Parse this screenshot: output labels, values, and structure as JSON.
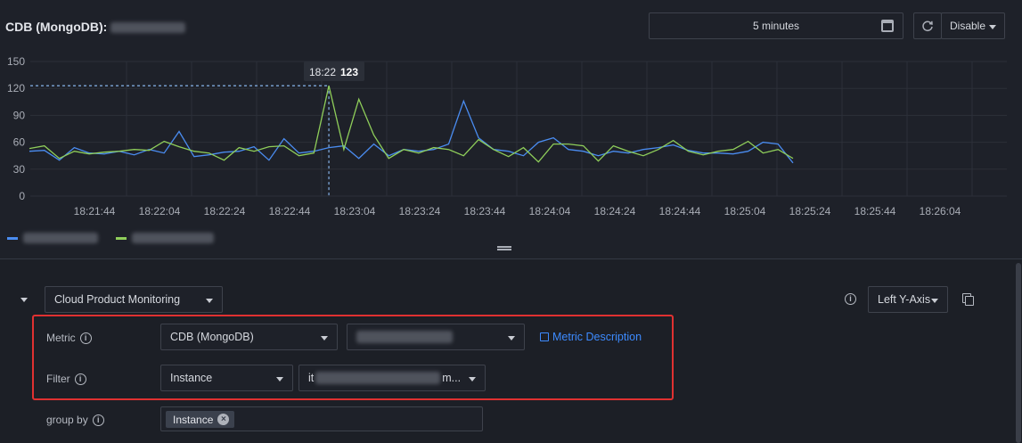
{
  "header": {
    "title": "CDB (MongoDB):",
    "time_range": "5 minutes",
    "auto_refresh": "Disable"
  },
  "colors": {
    "series_a": "#4a8cf0",
    "series_b": "#8fce5a",
    "accent_link": "#3d8bff",
    "highlight_box": "#e03131"
  },
  "chart_data": {
    "type": "line",
    "ylim": [
      0,
      150
    ],
    "y_ticks": [
      "150",
      "120",
      "90",
      "60",
      "30",
      "0"
    ],
    "x_ticks": [
      "18:21:44",
      "18:22:04",
      "18:22:24",
      "18:22:44",
      "18:23:04",
      "18:23:24",
      "18:23:44",
      "18:24:04",
      "18:24:24",
      "18:24:44",
      "18:25:04",
      "18:25:24",
      "18:25:44",
      "18:26:04"
    ],
    "tooltip": {
      "time": "18:22",
      "value": "123"
    },
    "series": [
      {
        "values": [
          50,
          51,
          40,
          54,
          48,
          47,
          50,
          46,
          52,
          48,
          72,
          44,
          46,
          49,
          50,
          55,
          40,
          64,
          48,
          50,
          54,
          56,
          42,
          58,
          45,
          52,
          50,
          52,
          58,
          106,
          65,
          52,
          50,
          45,
          60,
          65,
          52,
          50,
          45,
          50,
          48,
          52,
          54,
          57,
          51,
          48,
          48,
          47,
          50,
          60,
          58,
          37
        ]
      },
      {
        "values": [
          53,
          56,
          42,
          50,
          47,
          49,
          50,
          52,
          51,
          61,
          55,
          50,
          48,
          40,
          54,
          50,
          55,
          56,
          45,
          48,
          123,
          52,
          108,
          68,
          42,
          52,
          48,
          54,
          52,
          45,
          63,
          52,
          44,
          54,
          38,
          58,
          58,
          56,
          39,
          56,
          50,
          45,
          52,
          62,
          50,
          46,
          50,
          52,
          61,
          48,
          52,
          42
        ]
      }
    ]
  },
  "query": {
    "source": "Cloud Product Monitoring",
    "y_axis": "Left Y-Axis",
    "metric_label": "Metric",
    "metric_value": "CDB (MongoDB)",
    "metric_link": "Metric Description",
    "filter_label": "Filter",
    "filter_value": "Instance",
    "filter_instance_prefix": "it",
    "filter_instance_suffix": "m...",
    "groupby_label": "group by",
    "groupby_tag": "Instance",
    "info_glyph": "i",
    "close_glyph": "×"
  }
}
